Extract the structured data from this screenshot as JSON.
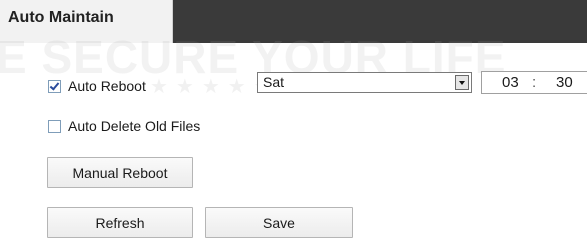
{
  "tab": {
    "label": "Auto Maintain"
  },
  "watermark": {
    "text": "E SECURE YOUR LIFE"
  },
  "auto_reboot": {
    "label": "Auto Reboot",
    "checked": true,
    "day_selected": "Sat",
    "time_hour": "03",
    "time_separator": ":",
    "time_minute": "30"
  },
  "auto_delete": {
    "label": "Auto Delete Old Files",
    "checked": false
  },
  "buttons": {
    "manual_reboot": "Manual Reboot",
    "refresh": "Refresh",
    "save": "Save"
  }
}
